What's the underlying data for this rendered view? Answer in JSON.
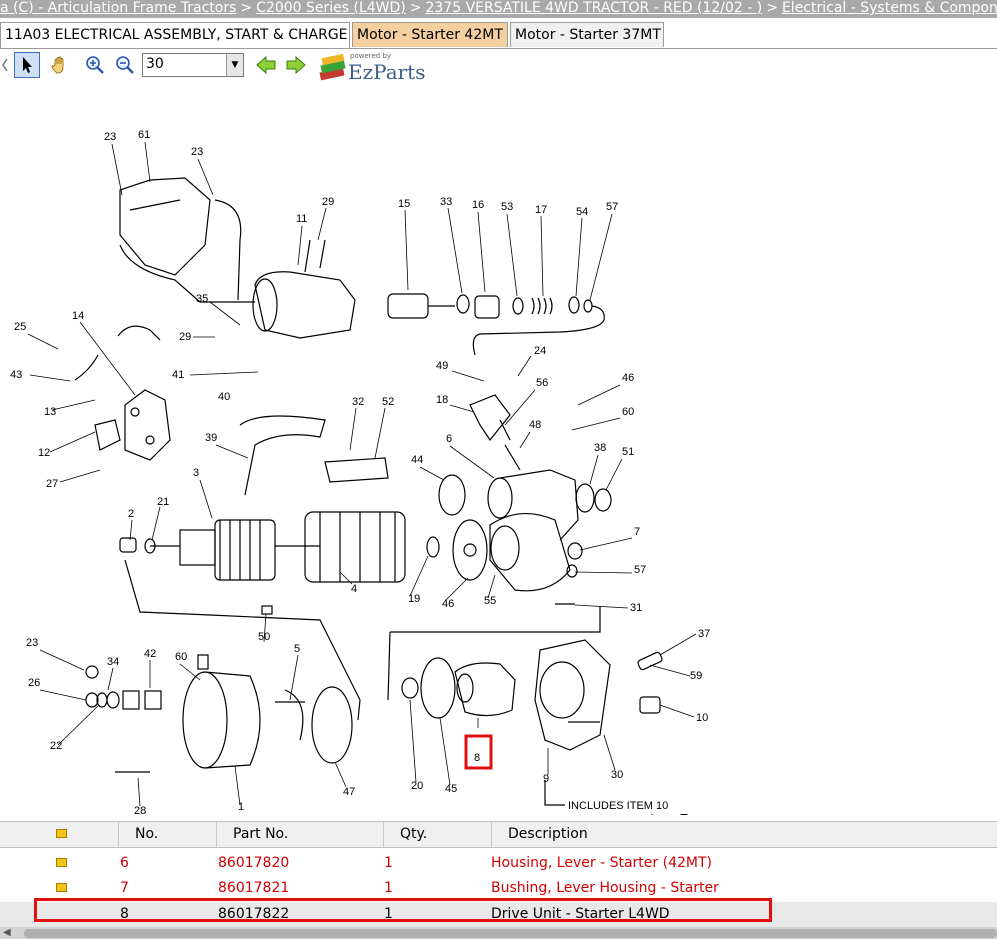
{
  "breadcrumb": {
    "items": [
      "a (C) - Articulation Frame Tractors",
      "C2000 Series (L4WD)",
      "2375 VERSATILE 4WD TRACTOR - RED (12/02 - )",
      "Electrical - Systems & Compon"
    ],
    "separator": ">"
  },
  "tabs": [
    {
      "label": "11A03 ELECTRICAL ASSEMBLY, START & CHARGE"
    },
    {
      "label": "Motor - Starter 42MT"
    },
    {
      "label": "Motor - Starter 37MT"
    }
  ],
  "toolbar": {
    "zoom_value": "30",
    "logo_powered": "powered by",
    "logo_brand": "EzParts"
  },
  "diagram": {
    "callouts": [
      "23",
      "61",
      "23",
      "29",
      "11",
      "15",
      "33",
      "16",
      "53",
      "17",
      "54",
      "57",
      "35",
      "29",
      "25",
      "14",
      "43",
      "41",
      "40",
      "13",
      "12",
      "27",
      "39",
      "3",
      "21",
      "2",
      "49",
      "24",
      "56",
      "18",
      "48",
      "46",
      "60",
      "6",
      "44",
      "32",
      "52",
      "38",
      "51",
      "7",
      "57",
      "19",
      "46",
      "55",
      "31",
      "4",
      "50",
      "23",
      "34",
      "42",
      "60",
      "5",
      "26",
      "22",
      "28",
      "1",
      "47",
      "20",
      "45",
      "8",
      "9",
      "30",
      "37",
      "59",
      "10"
    ],
    "note": "INCLUDES ITEM 10"
  },
  "grid": {
    "headers": [
      "No.",
      "Part No.",
      "Qty.",
      "Description"
    ],
    "rows": [
      {
        "no": "6",
        "part": "86017820",
        "qty": "1",
        "desc": "Housing, Lever - Starter (42MT)"
      },
      {
        "no": "7",
        "part": "86017821",
        "qty": "1",
        "desc": "Bushing, Lever Housing - Starter"
      },
      {
        "no": "8",
        "part": "86017822",
        "qty": "1",
        "desc": "Drive Unit - Starter L4WD"
      }
    ]
  }
}
